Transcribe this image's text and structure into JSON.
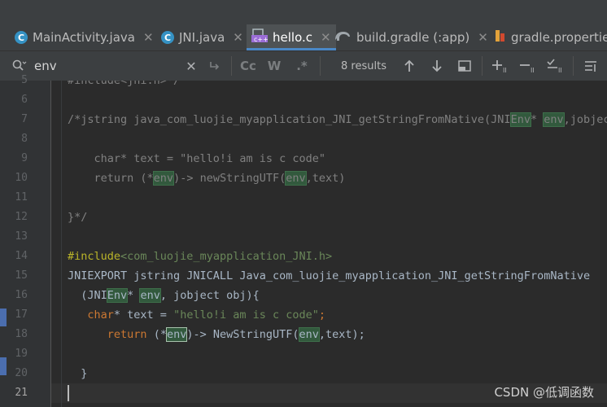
{
  "tabs": [
    {
      "label": "MainActivity.java",
      "icon": "java-class-icon"
    },
    {
      "label": "JNI.java",
      "icon": "java-class-icon"
    },
    {
      "label": "hello.c",
      "icon": "c-file-icon",
      "active": true
    },
    {
      "label": "build.gradle (:app)",
      "icon": "gradle-elephant-icon"
    },
    {
      "label": "gradle.properties",
      "icon": "gradle-properties-icon"
    }
  ],
  "find": {
    "query": "env",
    "results": "8 results",
    "match_case": "Cc",
    "words": "W",
    "regex": ".*"
  },
  "line_numbers": [
    "5",
    "6",
    "7",
    "8",
    "9",
    "10",
    "11",
    "12",
    "13",
    "14",
    "15",
    "16",
    "17",
    "18",
    "19",
    "20",
    "21"
  ],
  "code": {
    "l5": "#include<jni.h>*/",
    "l7_pre": "/*jstring java_com_luojie_myapplication_JNI_getStringFromNative(JNI",
    "l7_m1": "Env",
    "l7_mid": "* ",
    "l7_m2": "env",
    "l7_post": ",jobject",
    "l9": "    char* text = \"hello!i am is c code\"",
    "l10_pre": "    return (*",
    "l10_m1": "env",
    "l10_mid": ")-> newStringUTF(",
    "l10_m2": "env",
    "l10_post": ",text)",
    "l12": "}*/",
    "l14_kw": "#include",
    "l14_str": "<com_luojie_myapplication_JNI.h>",
    "l15": "JNIEXPORT jstring JNICALL Java_com_luojie_myapplication_JNI_getStringFromNative",
    "l16_pre": "  (JNI",
    "l16_m1": "Env",
    "l16_mid": "* ",
    "l16_m2": "env",
    "l16_post": ", jobject obj){",
    "l17_kw": "char",
    "l17_mid": "* text = ",
    "l17_str": "\"hello!i am is c code\"",
    "l17_end": ";",
    "l18_kw": "return",
    "l18_pre": " (*",
    "l18_m1": "env",
    "l18_mid": ")-> NewStringUTF(",
    "l18_m2": "env",
    "l18_post": ",text);",
    "l20": "  }"
  },
  "watermark": "CSDN @低调函数"
}
